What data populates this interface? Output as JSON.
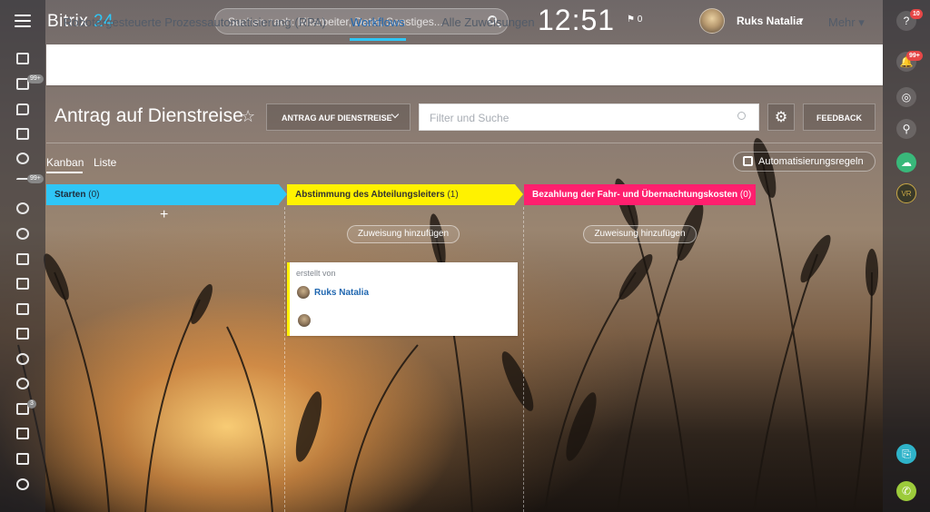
{
  "header": {
    "logo_main": "Bitrix",
    "logo_num": "24",
    "search_placeholder": "Suchen nach: Mitarbeiter, Datei, Sonstiges...",
    "clock": "12:51",
    "flag_count": "0",
    "user_name": "Ruks Natalia"
  },
  "left_badges": [
    "99+",
    "99+",
    "3"
  ],
  "right_badges": {
    "help": "10",
    "notifications": "99+"
  },
  "tabs": [
    "Robotergesteuerte Prozessautomatisierung (RPA)",
    "Workflows",
    "Alle Zuweisungen"
  ],
  "more": "Mehr",
  "page": {
    "title": "Antrag auf Dienstreise",
    "type_select": "ANTRAG AUF DIENSTREISE",
    "filter_placeholder": "Filter und Suche",
    "feedback": "FEEDBACK"
  },
  "views": [
    "Kanban",
    "Liste"
  ],
  "automation_rules": "Automatisierungsregeln",
  "columns": [
    {
      "title": "Starten",
      "count": "(0)",
      "color": "#2fc6f6"
    },
    {
      "title": "Abstimmung des Abteilungsleiters",
      "count": "(1)",
      "color": "#fff200"
    },
    {
      "title": "Bezahlung der Fahr- und Übernachtungskosten",
      "count": "(0)",
      "color": "#ff1f6e"
    }
  ],
  "assign_button": "Zuweisung hinzufügen",
  "card": {
    "created_by_label": "erstellt von",
    "author": "Ruks Natalia"
  }
}
